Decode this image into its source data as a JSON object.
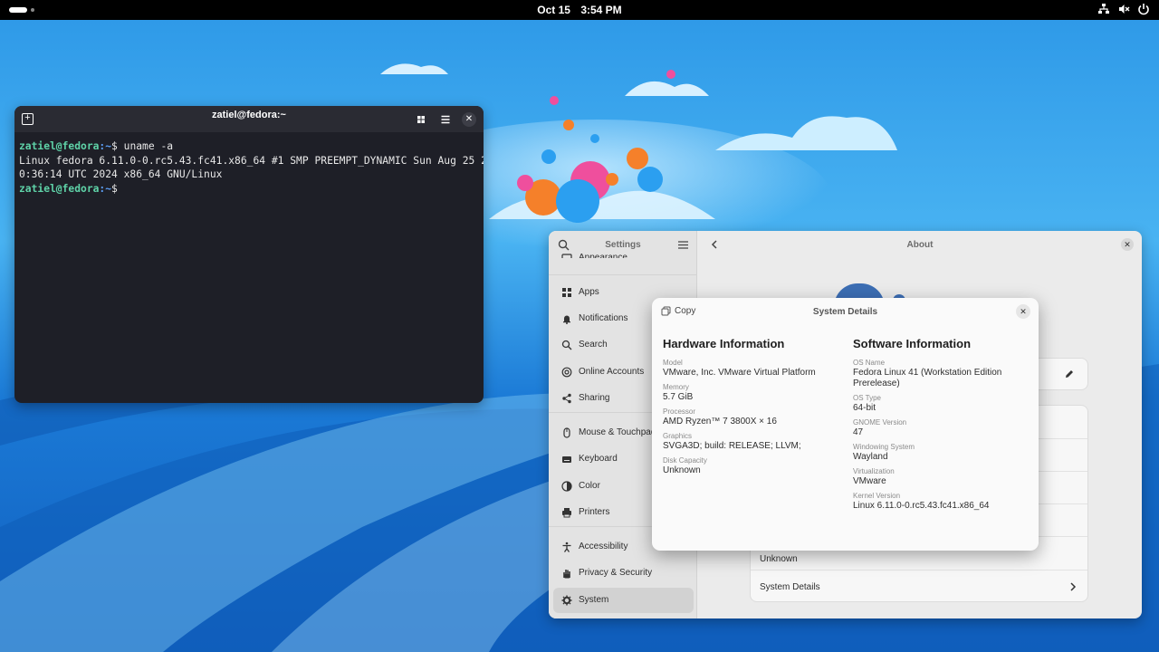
{
  "topbar": {
    "date": "Oct 15",
    "time": "3:54 PM"
  },
  "terminal": {
    "title": "zatiel@fedora:~",
    "lines": [
      {
        "user": "zatiel@fedora",
        "path": ":~",
        "sym": "$ ",
        "cmd": "uname -a"
      },
      {
        "out": "Linux fedora 6.11.0-0.rc5.43.fc41.x86_64 #1 SMP PREEMPT_DYNAMIC Sun Aug 25 2"
      },
      {
        "out": "0:36:14 UTC 2024 x86_64 GNU/Linux"
      },
      {
        "user": "zatiel@fedora",
        "path": ":~",
        "sym": "$",
        "cmd": ""
      }
    ]
  },
  "settings": {
    "sidebar_title": "Settings",
    "items": [
      {
        "label": "Appearance",
        "icon": "appearance-icon"
      },
      {
        "label": "Apps",
        "icon": "apps-icon"
      },
      {
        "label": "Notifications",
        "icon": "bell-icon"
      },
      {
        "label": "Search",
        "icon": "search-icon"
      },
      {
        "label": "Online Accounts",
        "icon": "at-icon"
      },
      {
        "label": "Sharing",
        "icon": "share-icon"
      },
      {
        "label": "Mouse & Touchpad",
        "icon": "mouse-icon"
      },
      {
        "label": "Keyboard",
        "icon": "keyboard-icon"
      },
      {
        "label": "Color",
        "icon": "color-icon"
      },
      {
        "label": "Printers",
        "icon": "printer-icon"
      },
      {
        "label": "Accessibility",
        "icon": "accessibility-icon"
      },
      {
        "label": "Privacy & Security",
        "icon": "hand-icon"
      },
      {
        "label": "System",
        "icon": "gear-icon"
      }
    ],
    "about": {
      "title": "About",
      "disk_value": "Unknown",
      "system_details": "System Details"
    }
  },
  "dialog": {
    "copy_label": "Copy",
    "title": "System Details",
    "hardware": {
      "heading": "Hardware Information",
      "fields": [
        {
          "k": "Model",
          "v": "VMware, Inc. VMware Virtual Platform"
        },
        {
          "k": "Memory",
          "v": "5.7 GiB"
        },
        {
          "k": "Processor",
          "v": "AMD Ryzen™ 7 3800X × 16"
        },
        {
          "k": "Graphics",
          "v": "SVGA3D; build: RELEASE; LLVM;"
        },
        {
          "k": "Disk Capacity",
          "v": "Unknown"
        }
      ]
    },
    "software": {
      "heading": "Software Information",
      "fields": [
        {
          "k": "OS Name",
          "v": "Fedora Linux 41 (Workstation Edition Prerelease)"
        },
        {
          "k": "OS Type",
          "v": "64-bit"
        },
        {
          "k": "GNOME Version",
          "v": "47"
        },
        {
          "k": "Windowing System",
          "v": "Wayland"
        },
        {
          "k": "Virtualization",
          "v": "VMware"
        },
        {
          "k": "Kernel Version",
          "v": "Linux 6.11.0-0.rc5.43.fc41.x86_64"
        }
      ]
    }
  }
}
